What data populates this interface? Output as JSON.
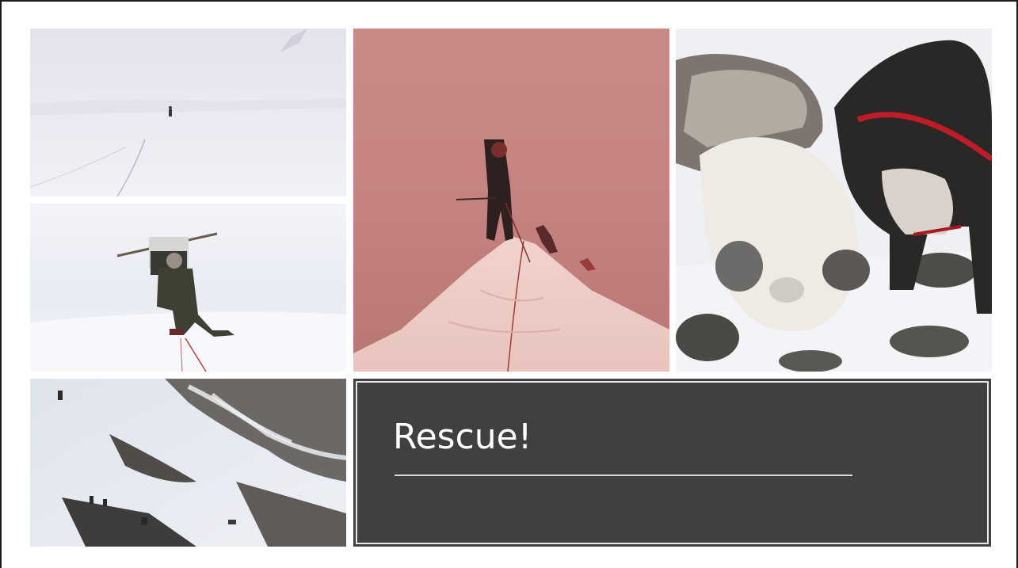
{
  "slide": {
    "title": "Rescue!"
  },
  "photos": [
    {
      "id": "p1",
      "subject": "climber-on-misty-glacier"
    },
    {
      "id": "p2",
      "subject": "climber-with-heavy-pack"
    },
    {
      "id": "p3",
      "subject": "climber-on-snow-summit"
    },
    {
      "id": "p4",
      "subject": "sled-dogs-in-snow"
    },
    {
      "id": "p5",
      "subject": "rocky-snow-slope-with-team"
    }
  ],
  "colors": {
    "title_background": "#404040",
    "title_text": "#ffffff",
    "frame": "#1a1a1a"
  }
}
